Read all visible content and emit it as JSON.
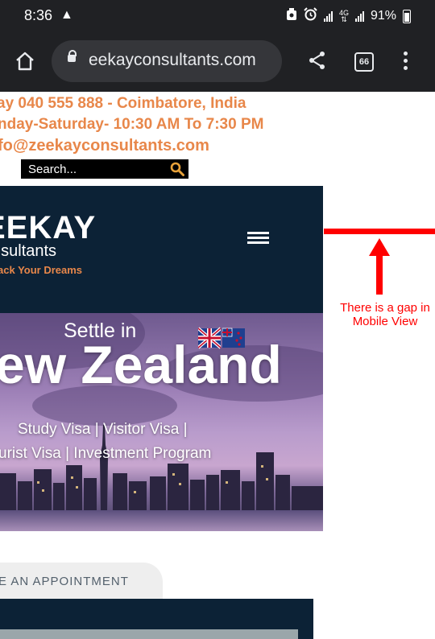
{
  "status_bar": {
    "time": "8:36",
    "network": "4G",
    "battery": "91%",
    "icons": [
      "alert-icon",
      "data-saver-icon",
      "alarm-icon",
      "signal-icon",
      "battery-icon"
    ]
  },
  "browser": {
    "url": "eekayconsultants.com",
    "tab_count": "66",
    "icons": [
      "home-icon",
      "lock-icon",
      "share-icon",
      "tabs-icon",
      "more-vert-icon"
    ]
  },
  "site": {
    "contact": {
      "phone_line": "ay 040 555 888  - Coimbatore, India",
      "hours_line": "nday-Saturday- 10:30 AM To 7:30 PM",
      "email_line": "fo@zeekayconsultants.com"
    },
    "search": {
      "placeholder": "Search..."
    },
    "logo": {
      "name": "EEKAY",
      "sub": "nsultants",
      "tagline": "ack Your Dreams"
    },
    "hero": {
      "pre_title": "Settle in",
      "title": "ew Zealand",
      "line1": "Study Visa | Visitor Visa |",
      "line2": "urist Visa | Investment Program"
    },
    "appointment": {
      "label": "E AN APPOINTMENT"
    }
  },
  "annotation": {
    "text_line1": "There is a gap in",
    "text_line2": "Mobile View"
  },
  "colors": {
    "status_bg": "#202124",
    "accent_orange": "#e8874a",
    "header_navy": "#0c2236",
    "annotation_red": "#ff0000"
  }
}
